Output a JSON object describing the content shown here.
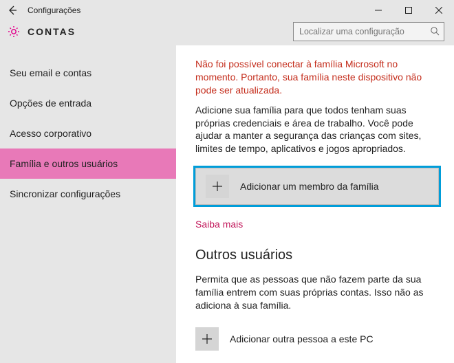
{
  "window": {
    "title": "Configurações"
  },
  "header": {
    "title": "CONTAS"
  },
  "search": {
    "placeholder": "Localizar uma configuração"
  },
  "sidebar": {
    "items": [
      {
        "label": "Seu email e contas"
      },
      {
        "label": "Opções de entrada"
      },
      {
        "label": "Acesso corporativo"
      },
      {
        "label": "Família e outros usuários"
      },
      {
        "label": "Sincronizar configurações"
      }
    ],
    "active_index": 3
  },
  "main": {
    "error": "Não foi possível conectar à família Microsoft no momento. Portanto, sua família neste dispositivo não pode ser atualizada.",
    "desc": "Adicione sua família para que todos tenham suas próprias credenciais e área de trabalho. Você pode ajudar a manter a segurança das crianças com sites, limites de tempo, aplicativos e jogos apropriados.",
    "add_family_label": "Adicionar um membro da família",
    "learn_more": "Saiba mais",
    "other_users_heading": "Outros usuários",
    "other_users_desc": "Permita que as pessoas que não fazem parte da sua família entrem com suas próprias contas. Isso não as adiciona à sua família.",
    "add_other_label": "Adicionar outra pessoa a este PC"
  }
}
